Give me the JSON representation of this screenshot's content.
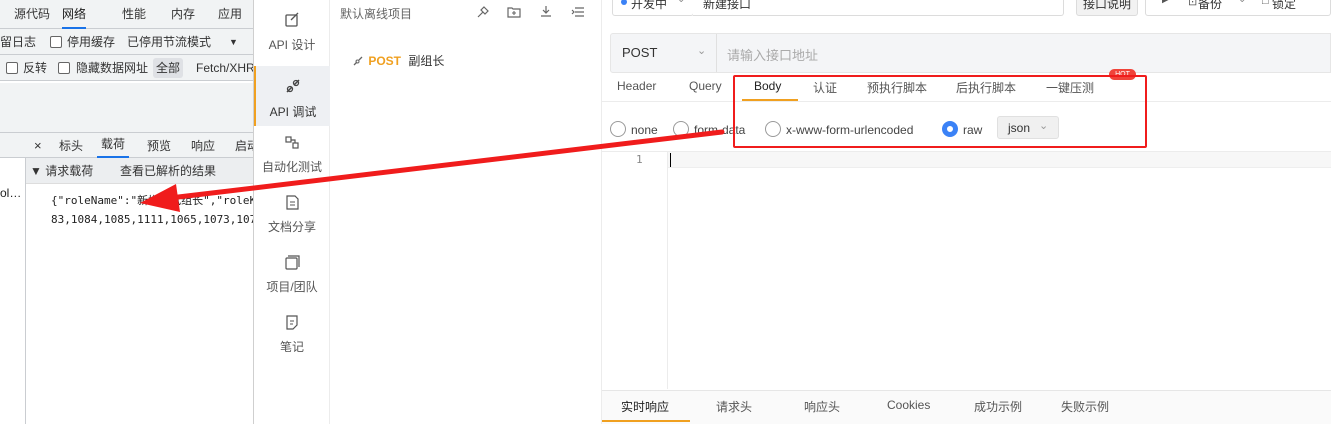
{
  "devtools": {
    "tabs": [
      "源代码",
      "网络",
      "性能",
      "内存",
      "应用"
    ],
    "active_tab": "网络",
    "options_row": {
      "preserve_log": "留日志",
      "disable_cache": "停用缓存",
      "throttle": "已停用节流模式"
    },
    "filter_row": {
      "invert": "反转",
      "hide_data_urls": "隐藏数据网址",
      "all": "全部",
      "fetch_xhr": "Fetch/XHR"
    },
    "detail_tabs": [
      "标头",
      "载荷",
      "预览",
      "响应",
      "启动"
    ],
    "active_detail_tab": "载荷",
    "payload_section": "▼ 请求载荷",
    "view_parsed": "查看已解析的结果",
    "request_list_item": "ol…",
    "payload_lines": [
      "{\"roleName\":\"新增测试组长\",\"roleKey",
      "83,1084,1085,1111,1065,1073,107"
    ]
  },
  "nav": {
    "items": [
      {
        "label": "API 设计",
        "icon": "api-design-icon"
      },
      {
        "label": "API 调试",
        "icon": "api-debug-icon"
      },
      {
        "label": "自动化测试",
        "icon": "automation-test-icon"
      },
      {
        "label": "文档分享",
        "icon": "doc-share-icon"
      },
      {
        "label": "项目/团队",
        "icon": "project-team-icon"
      },
      {
        "label": "笔记",
        "icon": "notes-icon"
      }
    ],
    "active_index": 1
  },
  "tree": {
    "title": "默认离线项目",
    "items": [
      {
        "method": "POST",
        "name": "副组长"
      }
    ]
  },
  "main": {
    "env": "开发中",
    "request_name": "新建接口",
    "doc_button": "接口说明",
    "backup": "备份",
    "lock": "锁定",
    "method": "POST",
    "url_placeholder": "请输入接口地址",
    "tabs": [
      "Header",
      "Query",
      "Body",
      "认证",
      "预执行脚本",
      "后执行脚本",
      "一键压测"
    ],
    "active_tab": "Body",
    "hot_badge": "HOT",
    "body_types": [
      "none",
      "form-data",
      "x-www-form-urlencoded",
      "raw"
    ],
    "selected_body_type": "raw",
    "raw_format": "json",
    "editor_line": "1",
    "response_tabs": [
      "实时响应",
      "请求头",
      "响应头",
      "Cookies",
      "成功示例",
      "失败示例"
    ],
    "active_response_tab": "实时响应"
  },
  "colors": {
    "accent": "#f0a020",
    "annotation": "#f01c1c",
    "post_method": "#f0a020",
    "radio_selected": "#3b82f6",
    "devtools_blue": "#1a73e8"
  }
}
